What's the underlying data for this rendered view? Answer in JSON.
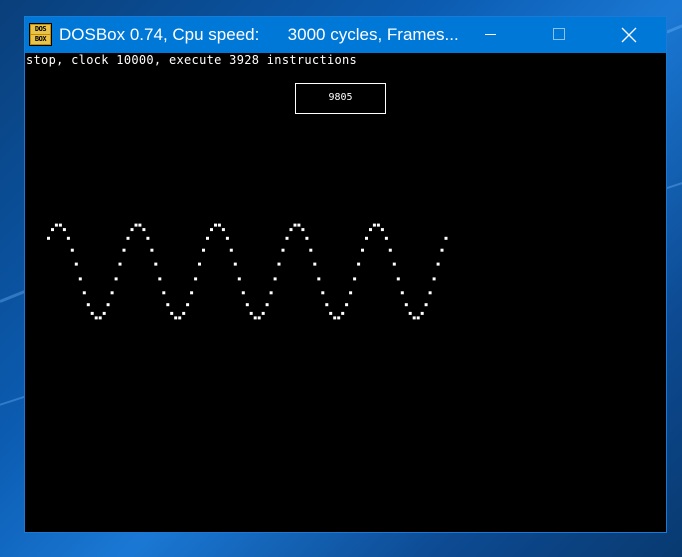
{
  "window": {
    "title": "DOSBox 0.74, Cpu speed:      3000 cycles, Frames...",
    "icon": "dosbox-icon",
    "icon_text_top": "DOS",
    "icon_text_bottom": "BOX",
    "controls": [
      "minimize-icon",
      "maximize-icon",
      "close-icon"
    ]
  },
  "screen": {
    "status_line": "stop, clock 10000, execute 3928 instructions",
    "counter": "9805"
  },
  "colors": {
    "titlebar": "#0078d7",
    "screen_bg": "#000000",
    "foreground": "#ffffff"
  },
  "waveform": {
    "type": "dotted-sine",
    "cycles_shown": 5,
    "points_per_cycle": 20
  }
}
